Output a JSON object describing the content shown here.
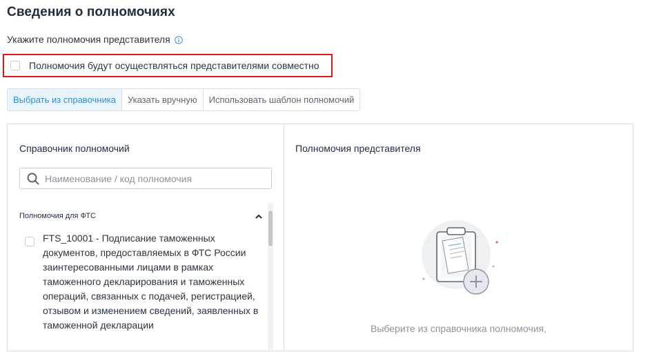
{
  "section": {
    "title": "Сведения о полномочиях",
    "subtitle": "Укажите полномочия представителя"
  },
  "joint": {
    "label": "Полномочия будут осуществляться представителями совместно",
    "checked": false
  },
  "tabs": [
    {
      "label": "Выбрать из справочника",
      "active": true
    },
    {
      "label": "Указать вручную",
      "active": false
    },
    {
      "label": "Использовать шаблон полномочий",
      "active": false
    }
  ],
  "catalog": {
    "title": "Справочник полномочий",
    "search_placeholder": "Наименование / код полномочия",
    "group_label": "Полномочия для ФТС",
    "items": [
      {
        "text": "FTS_10001 - Подписание таможенных документов, предоставляемых в ФТС России заинтересованными лицами в рамках таможенного декларирования и таможенных операций, связанных с подачей, регистрацией, отзывом и изменением сведений, заявленных в таможенной декларации",
        "checked": false
      }
    ]
  },
  "selected": {
    "title": "Полномочия представителя",
    "empty_hint": "Выберите из справочника полномочия,"
  },
  "colors": {
    "accent": "#2f8fd0",
    "highlight_border": "#e0141b",
    "border": "#d7dde4"
  }
}
